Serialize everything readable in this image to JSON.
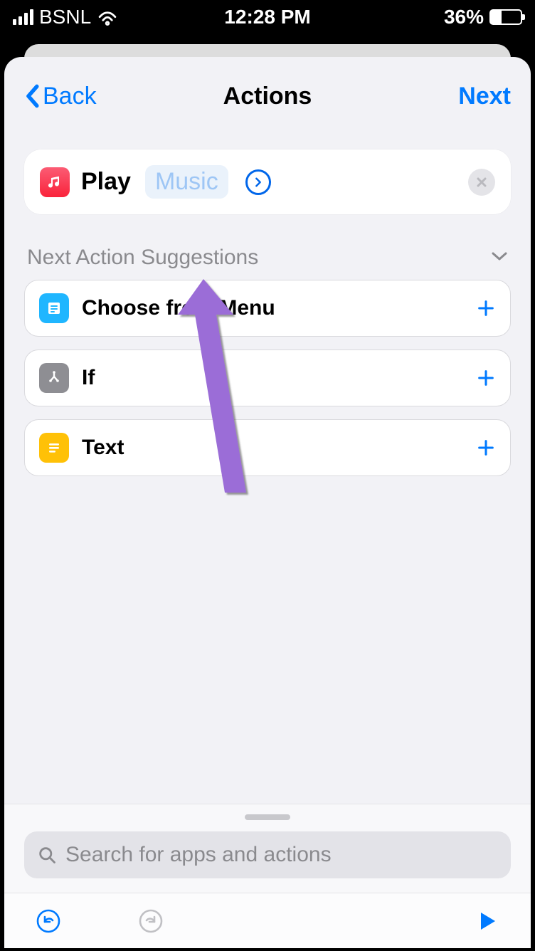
{
  "status_bar": {
    "carrier": "BSNL",
    "time": "12:28 PM",
    "battery_percent": "36%"
  },
  "nav": {
    "back_label": "Back",
    "title": "Actions",
    "next_label": "Next"
  },
  "action_card": {
    "verb": "Play",
    "parameter": "Music"
  },
  "suggestions": {
    "header": "Next Action Suggestions",
    "items": [
      {
        "label": "Choose from Menu"
      },
      {
        "label": "If"
      },
      {
        "label": "Text"
      }
    ]
  },
  "search": {
    "placeholder": "Search for apps and actions"
  }
}
